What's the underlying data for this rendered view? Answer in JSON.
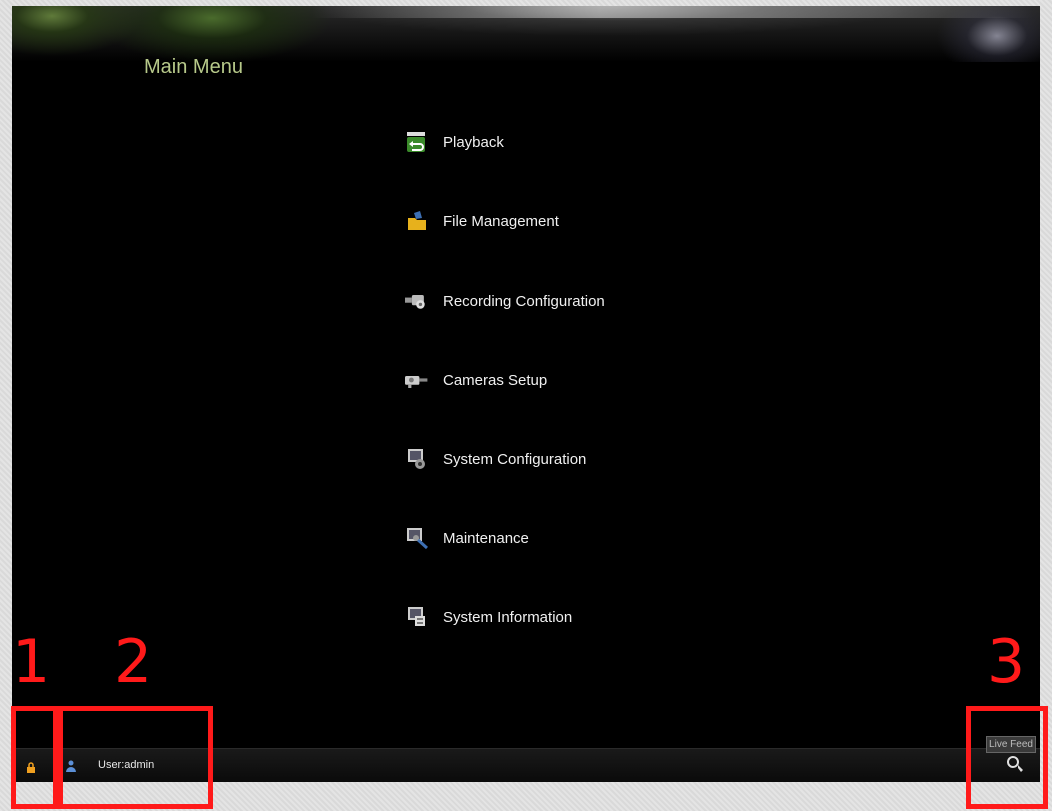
{
  "screen": {
    "title": "Main Menu"
  },
  "menu": {
    "items": [
      {
        "label": "Playback",
        "icon": "playback-icon"
      },
      {
        "label": "File Management",
        "icon": "folder-icon"
      },
      {
        "label": "Recording Configuration",
        "icon": "camcorder-icon"
      },
      {
        "label": "Cameras Setup",
        "icon": "camera-setup-icon"
      },
      {
        "label": "System Configuration",
        "icon": "system-config-icon"
      },
      {
        "label": "Maintenance",
        "icon": "maintenance-icon"
      },
      {
        "label": "System Information",
        "icon": "system-info-icon"
      }
    ]
  },
  "status_bar": {
    "user_text": "User:admin",
    "lock_icon": "lock-icon",
    "user_icon": "user-icon",
    "live_feed_tooltip": "Live Feed",
    "live_feed_icon": "live-feed-icon"
  },
  "annotations": {
    "labels": [
      "1",
      "2",
      "3"
    ],
    "color": "#ff1a1a"
  },
  "colors": {
    "title": "#b7c98a",
    "menu_text": "#f0f0f0",
    "background": "#000000"
  }
}
